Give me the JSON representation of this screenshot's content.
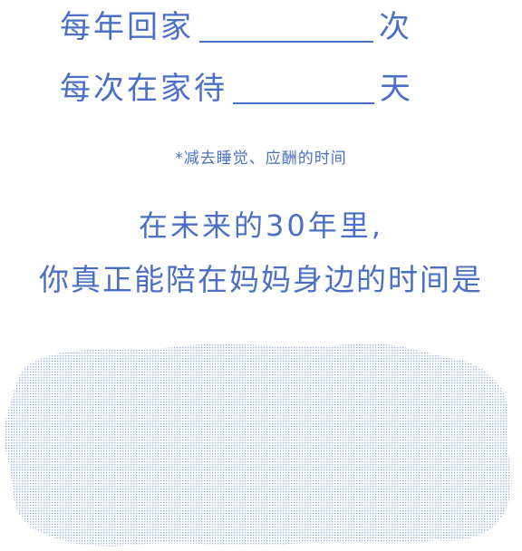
{
  "form": {
    "row1": {
      "label": "每年回家",
      "suffix": "次"
    },
    "row2": {
      "label": "每次在家待",
      "suffix": "天"
    }
  },
  "note": "*减去睡觉、应酬的时间",
  "question": {
    "line1": "在未来的30年里,",
    "line2": "你真正能陪在妈妈身边的时间是"
  },
  "colors": {
    "text": "#4a6fc4",
    "scratch": "#b8c6e6"
  }
}
